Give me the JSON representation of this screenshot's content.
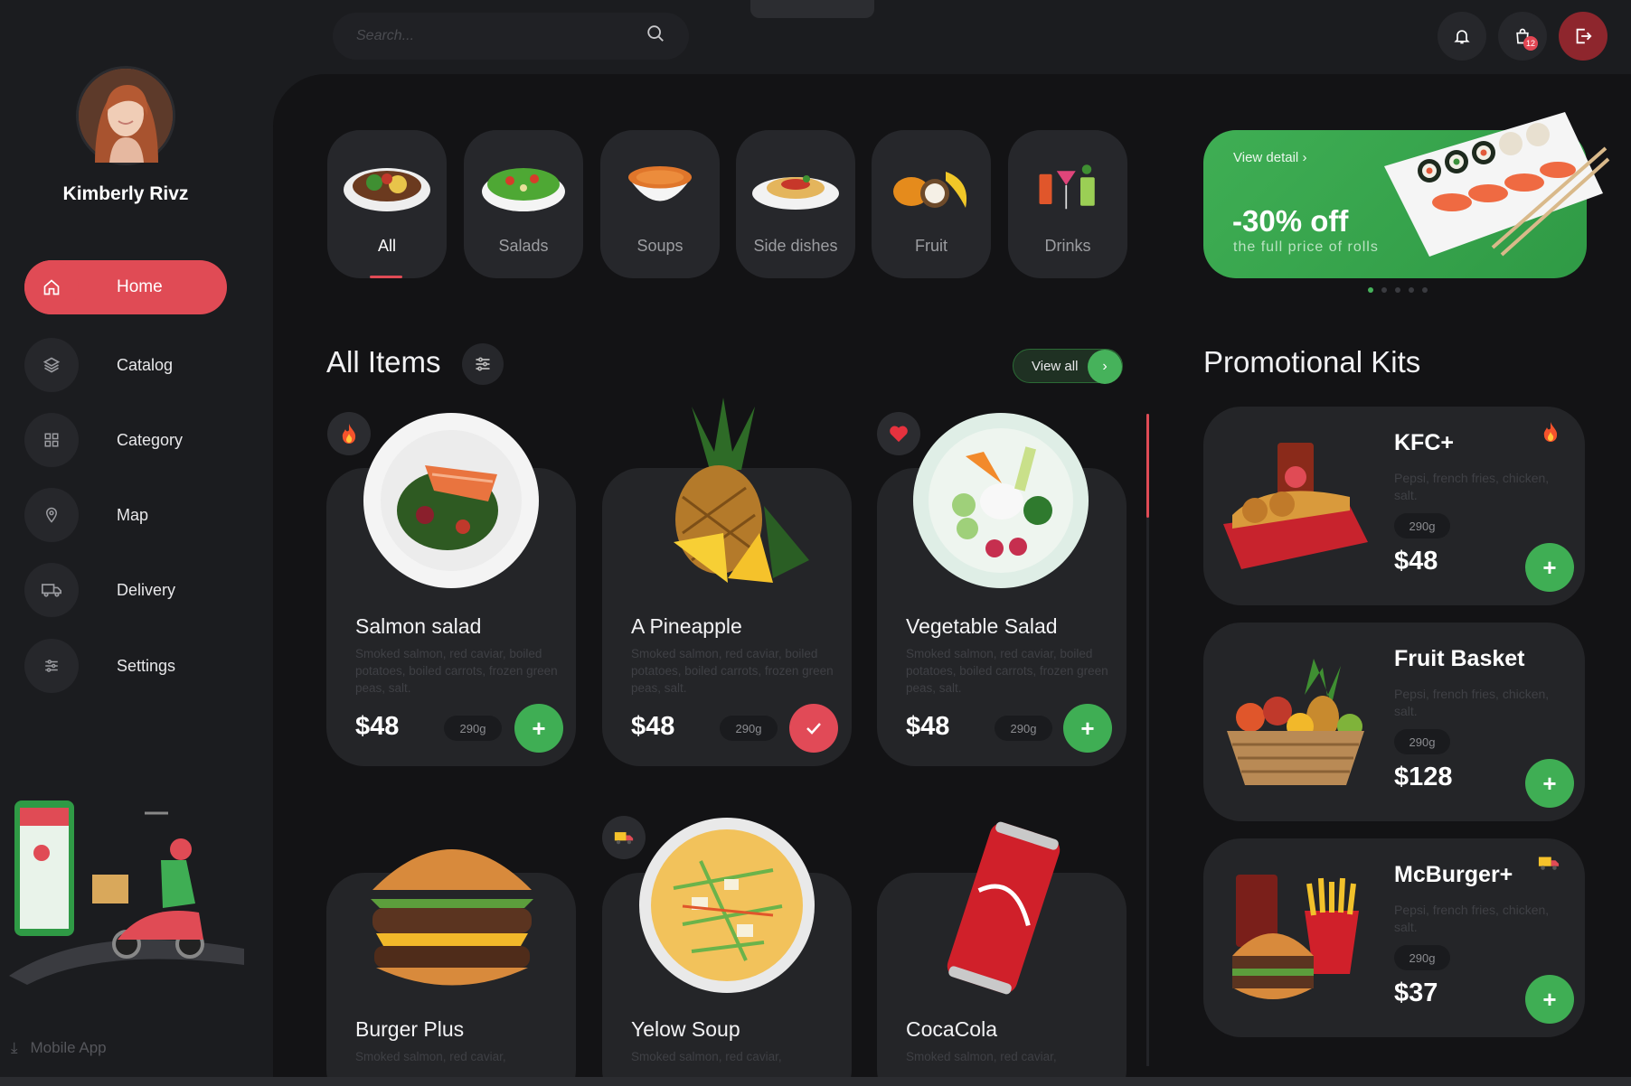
{
  "colors": {
    "accent_red": "#e04b55",
    "accent_green": "#3fae54",
    "background": "#131315",
    "card": "#242528"
  },
  "user": {
    "name": "Kimberly Rivz"
  },
  "sidebar": {
    "items": [
      {
        "label": "Home",
        "icon": "home-icon",
        "active": true
      },
      {
        "label": "Catalog",
        "icon": "layers-icon"
      },
      {
        "label": "Category",
        "icon": "grid-icon"
      },
      {
        "label": "Map",
        "icon": "map-pin-icon"
      },
      {
        "label": "Delivery",
        "icon": "truck-icon"
      },
      {
        "label": "Settings",
        "icon": "sliders-icon"
      }
    ],
    "mobile_app": "Mobile App"
  },
  "search": {
    "placeholder": "Search..."
  },
  "topbar": {
    "cart_count": "12"
  },
  "categories": [
    {
      "label": "All",
      "active": true
    },
    {
      "label": "Salads"
    },
    {
      "label": "Soups"
    },
    {
      "label": "Side dishes"
    },
    {
      "label": "Fruit"
    },
    {
      "label": "Drinks"
    }
  ],
  "banner": {
    "link": "View detail",
    "discount": "-30% off",
    "subtitle": "the full price of rolls",
    "slides": 5,
    "active_slide": 1
  },
  "all_items": {
    "title": "All Items",
    "view_all": "View all",
    "items": [
      {
        "name": "Salmon salad",
        "desc": "Smoked salmon, red caviar, boiled potatoes, boiled carrots, frozen green peas, salt.",
        "price": "$48",
        "weight": "290g",
        "badge": "fire-icon",
        "state": "add"
      },
      {
        "name": "A Pineapple",
        "desc": "Smoked salmon, red caviar, boiled potatoes, boiled carrots, frozen green peas, salt.",
        "price": "$48",
        "weight": "290g",
        "badge": "",
        "state": "added"
      },
      {
        "name": "Vegetable Salad",
        "desc": "Smoked salmon, red caviar, boiled potatoes, boiled carrots, frozen green peas, salt.",
        "price": "$48",
        "weight": "290g",
        "badge": "heart-icon",
        "state": "add"
      },
      {
        "name": "Burger Plus",
        "desc": "Smoked salmon, red caviar,"
      },
      {
        "name": "Yelow Soup",
        "desc": "Smoked salmon, red caviar,",
        "badge": "truck-icon"
      },
      {
        "name": "CocaCola",
        "desc": "Smoked salmon, red caviar,"
      }
    ]
  },
  "promo_kits": {
    "title": "Promotional Kits",
    "kits": [
      {
        "name": "KFC+",
        "desc": "Pepsi, french fries, chicken, salt.",
        "weight": "290g",
        "price": "$48",
        "badge": "fire-icon"
      },
      {
        "name": "Fruit Basket",
        "desc": "Pepsi, french fries, chicken, salt.",
        "weight": "290g",
        "price": "$128",
        "badge": ""
      },
      {
        "name": "McBurger+",
        "desc": "Pepsi, french fries, chicken, salt.",
        "weight": "290g",
        "price": "$37",
        "badge": "truck-icon"
      }
    ]
  }
}
